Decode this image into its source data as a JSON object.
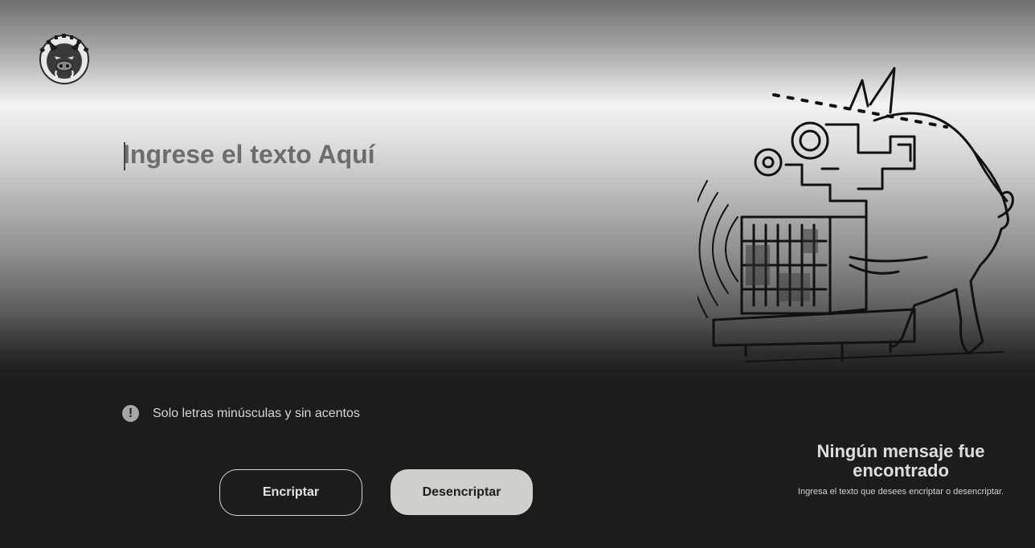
{
  "logo": {
    "name": "pig-logo",
    "text": "WILLPIG"
  },
  "input": {
    "placeholder": "Ingrese el texto Aquí",
    "value": ""
  },
  "hint": {
    "icon": "exclamation-icon",
    "text": "Solo letras minúsculas y sin acentos"
  },
  "buttons": {
    "encrypt_label": "Encriptar",
    "decrypt_label": "Desencriptar"
  },
  "output": {
    "illustration": "pig-machine-illustration",
    "title": "Ningún mensaje fue encontrado",
    "subtitle": "Ingresa el texto que desees encriptar o desencriptar."
  },
  "colors": {
    "background_dark": "#1c1c1b",
    "button_light": "#cfcfcc",
    "text_light": "#dedfdd"
  }
}
